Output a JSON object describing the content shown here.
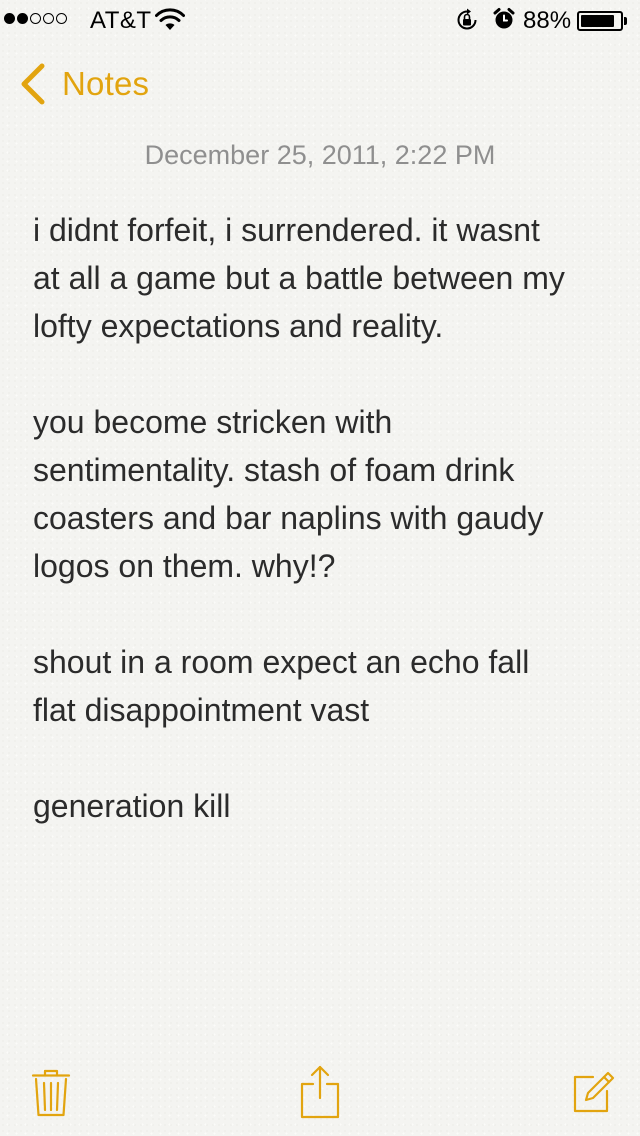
{
  "status_bar": {
    "carrier": "AT&T",
    "signal_bars_total": 5,
    "signal_bars_filled": 2,
    "battery_percent_label": "88%",
    "battery_level": 0.88,
    "icons": [
      "wifi-icon",
      "rotation-lock-icon",
      "alarm-icon",
      "battery-icon"
    ]
  },
  "nav": {
    "back_label": "Notes"
  },
  "note": {
    "date": "December 25, 2011, 2:22 PM",
    "paragraphs": [
      [
        "i didnt forfeit, i surrendered. it wasnt",
        "at all a game but a battle between my",
        "lofty expectations and reality."
      ],
      [
        "you become stricken with",
        "sentimentality. stash of foam drink",
        "coasters and bar naplins with gaudy",
        "logos on them.  why!?"
      ],
      [
        "shout in a room expect an echo fall",
        "flat disappointment vast"
      ],
      [
        "generation kill"
      ]
    ]
  },
  "toolbar": {
    "icons": [
      "trash-icon",
      "share-icon",
      "compose-icon"
    ]
  },
  "colors": {
    "accent": "#e2a40f",
    "date_text": "#8f8f8f",
    "body_text": "#2b2b2b",
    "background": "#f4f4f1"
  }
}
